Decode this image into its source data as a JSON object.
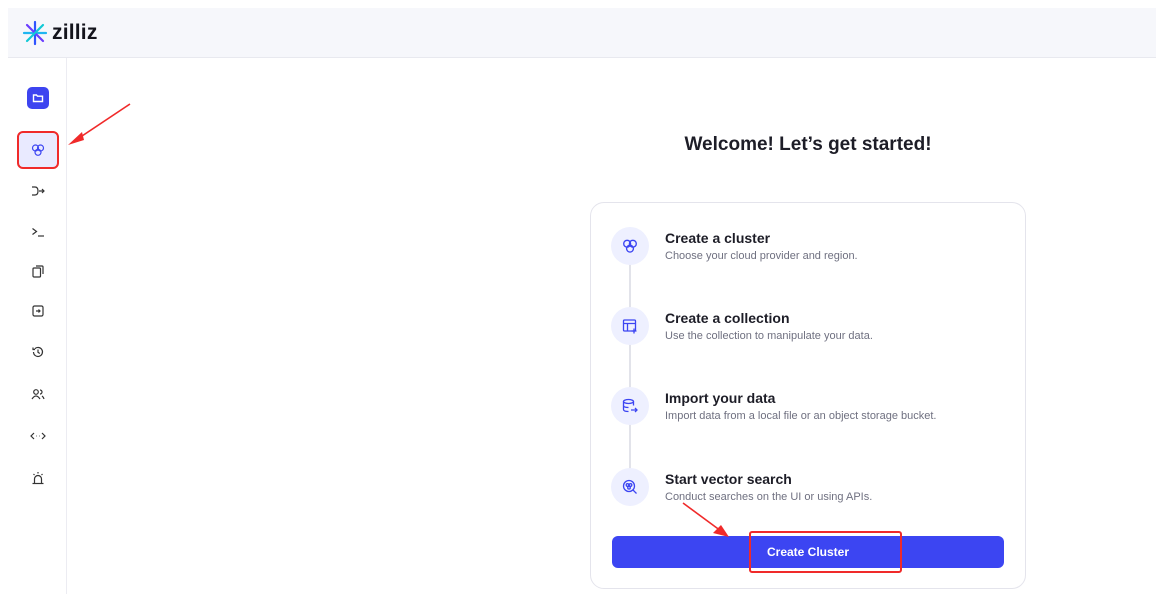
{
  "app": {
    "logo_text": "zilliz"
  },
  "sidebar": {
    "items": [
      {
        "id": "projects",
        "icon": "folder-icon"
      },
      {
        "id": "clusters",
        "icon": "clusters-icon",
        "active": true
      },
      {
        "id": "pipelines",
        "icon": "pipeline-icon"
      },
      {
        "id": "cli",
        "icon": "terminal-icon"
      },
      {
        "id": "backups",
        "icon": "copy-icon"
      },
      {
        "id": "migrations",
        "icon": "import-icon"
      },
      {
        "id": "activity",
        "icon": "history-icon"
      },
      {
        "id": "members",
        "icon": "users-icon"
      },
      {
        "id": "api-keys",
        "icon": "code-icon"
      },
      {
        "id": "alerts",
        "icon": "alarm-icon"
      }
    ]
  },
  "main": {
    "welcome_title": "Welcome! Let’s get started!",
    "steps": [
      {
        "title": "Create a cluster",
        "description": "Choose your cloud provider and region.",
        "icon": "clusters-icon"
      },
      {
        "title": "Create a collection",
        "description": "Use the collection to manipulate your data.",
        "icon": "collection-icon"
      },
      {
        "title": "Import your data",
        "description": "Import data from a local file or an object storage bucket.",
        "icon": "database-import-icon"
      },
      {
        "title": "Start vector search",
        "description": "Conduct searches on the UI or using APIs.",
        "icon": "vector-search-icon"
      }
    ],
    "create_button_label": "Create Cluster"
  },
  "colors": {
    "accent": "#3c45f2",
    "annotation": "#f02a2a",
    "step_icon_bg": "#eef0ff"
  }
}
